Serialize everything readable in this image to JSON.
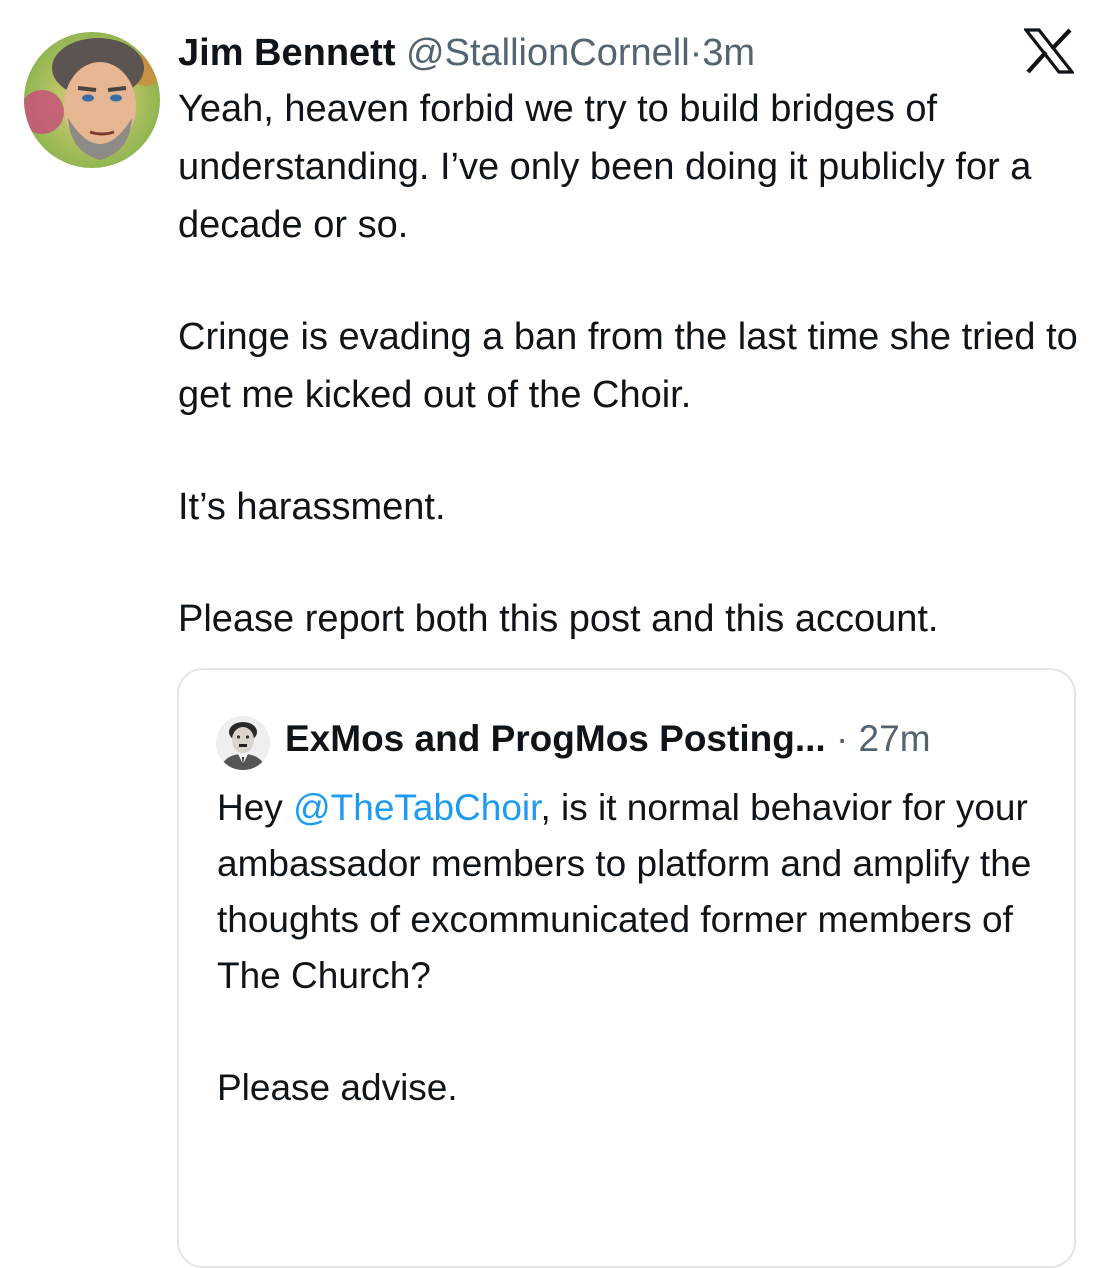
{
  "tweet": {
    "author": {
      "name": "Jim Bennett",
      "handle": "@StallionCornell",
      "separator": "·",
      "time": "3m",
      "avatar_icon": "portrait-avatar-icon"
    },
    "platform_icon": "x-logo-icon",
    "paragraphs": [
      "Yeah, heaven forbid we try to build bridges of understanding. I’ve only been doing it publicly for a decade or so.",
      "Cringe is evading a ban from the last time she tried to get me kicked out of the Choir.",
      "It’s harassment.",
      "Please report both this post and this account."
    ]
  },
  "quoted_tweet": {
    "author": {
      "name": "ExMos and ProgMos Posting...",
      "separator": "·",
      "time": "27m",
      "avatar_icon": "vintage-portrait-avatar-icon"
    },
    "body_prefix": "Hey ",
    "mention": "@TheTabChoir",
    "body_suffix": ", is it normal behavior for your ambassador members to platform and amplify the thoughts of excommunicated former members of The Church?",
    "closing": "Please advise."
  },
  "colors": {
    "text": "#0f1419",
    "secondary": "#536471",
    "link": "#1d9bf0",
    "border": "#e1e6ea"
  }
}
